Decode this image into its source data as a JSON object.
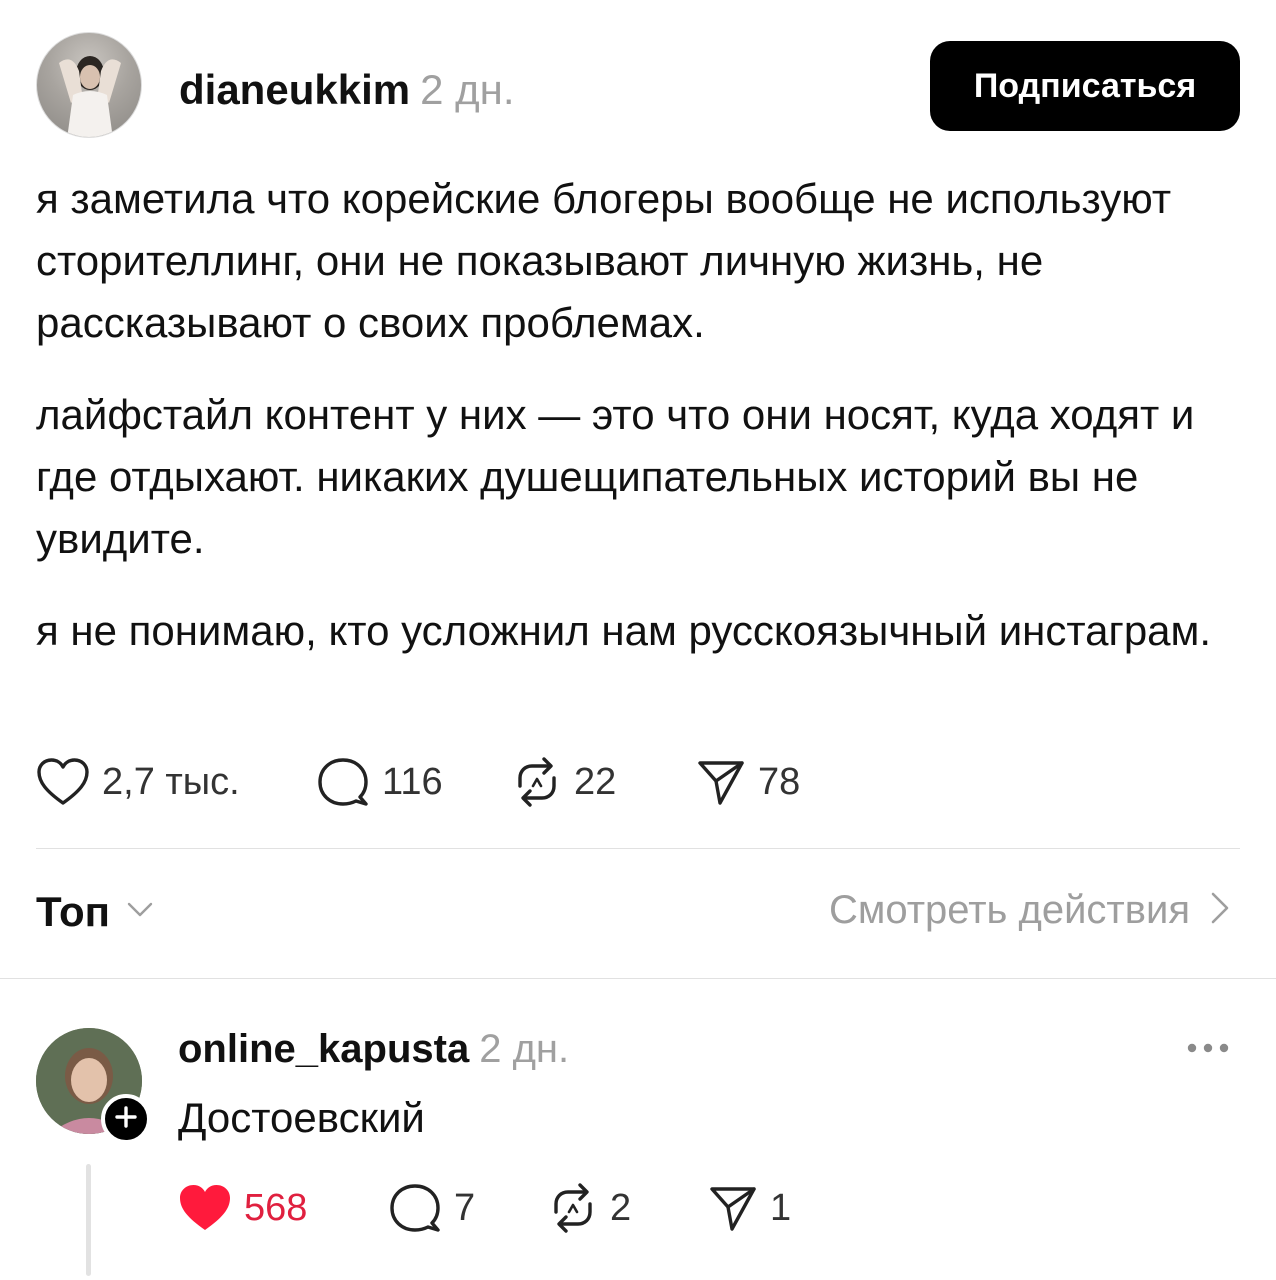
{
  "post": {
    "author": "dianeukkim",
    "time": "2 дн.",
    "follow_label": "Подписаться",
    "paragraphs": [
      "я заметила что корейские блогеры вообще не используют сторителлинг, они не показывают личную жизнь, не рассказывают о своих проблемах.",
      "лайфстайл контент у них — это что они носят, куда ходят и где отдыхают. никаких душещипательных историй вы не увидите.",
      "я не понимаю, кто усложнил нам русскоязычный инстаграм."
    ],
    "stats": {
      "likes": "2,7 тыс.",
      "comments": "116",
      "reposts": "22",
      "shares": "78"
    }
  },
  "sort": {
    "label": "Топ",
    "activity_label": "Смотреть действия"
  },
  "comment": {
    "author": "online_kapusta",
    "time": "2 дн.",
    "text": "Достоевский",
    "liked": true,
    "stats": {
      "likes": "568",
      "comments": "7",
      "reposts": "2",
      "shares": "1"
    }
  },
  "icons": {
    "like": "heart-icon",
    "comment": "comment-bubble-icon",
    "repost": "repost-icon",
    "share": "send-icon",
    "more": "more-dots-icon",
    "sort": "chevron-down-icon",
    "activity": "chevron-right-icon",
    "follow": "plus-icon"
  },
  "colors": {
    "like_active": "#ff1a3c",
    "like_count_active": "#e0203f",
    "muted": "#a0a0a0",
    "primary_button": "#000000"
  }
}
